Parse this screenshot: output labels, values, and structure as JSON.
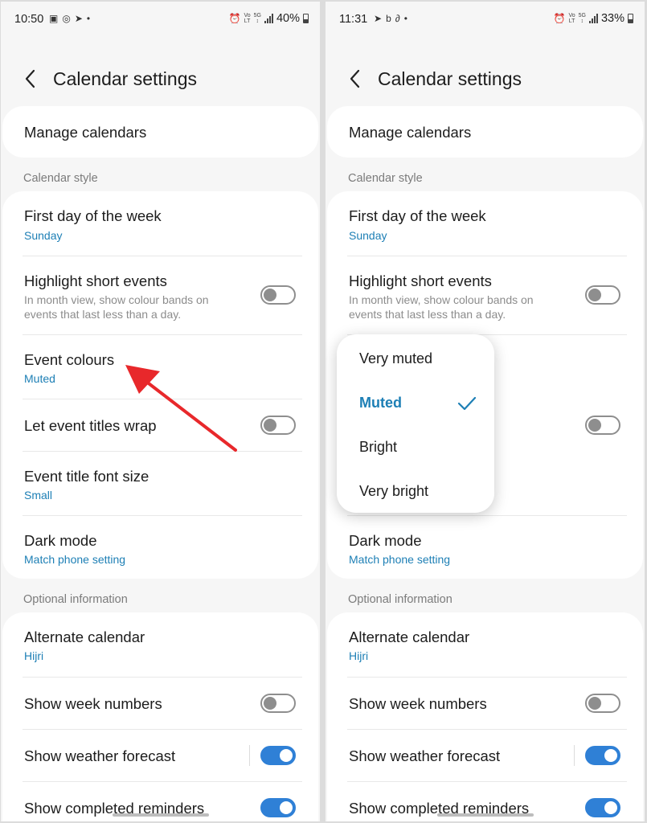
{
  "left": {
    "status": {
      "time": "10:50",
      "battery": "40%",
      "dot": "•"
    },
    "title": "Calendar settings",
    "manage": "Manage calendars",
    "section_style": "Calendar style",
    "first_day": {
      "label": "First day of the week",
      "value": "Sunday"
    },
    "highlight": {
      "label": "Highlight short events",
      "desc": "In month view, show colour bands on events that last less than a day."
    },
    "event_colours": {
      "label": "Event colours",
      "value": "Muted"
    },
    "wrap": {
      "label": "Let event titles wrap"
    },
    "font_size": {
      "label": "Event title font size",
      "value": "Small"
    },
    "dark_mode": {
      "label": "Dark mode",
      "value": "Match phone setting"
    },
    "section_optional": "Optional information",
    "alt_cal": {
      "label": "Alternate calendar",
      "value": "Hijri"
    },
    "week_numbers": {
      "label": "Show week numbers"
    },
    "weather": {
      "label": "Show weather forecast"
    },
    "reminders": {
      "label": "Show completed reminders"
    }
  },
  "right": {
    "status": {
      "time": "11:31",
      "battery": "33%",
      "dot": "•"
    },
    "title": "Calendar settings",
    "manage": "Manage calendars",
    "section_style": "Calendar style",
    "first_day": {
      "label": "First day of the week",
      "value": "Sunday"
    },
    "highlight": {
      "label": "Highlight short events",
      "desc": "In month view, show colour bands on events that last less than a day."
    },
    "dark_mode": {
      "label": "Dark mode",
      "value": "Match phone setting"
    },
    "section_optional": "Optional information",
    "alt_cal": {
      "label": "Alternate calendar",
      "value": "Hijri"
    },
    "week_numbers": {
      "label": "Show week numbers"
    },
    "weather": {
      "label": "Show weather forecast"
    },
    "reminders": {
      "label": "Show completed reminders"
    },
    "popup": {
      "options": [
        "Very muted",
        "Muted",
        "Bright",
        "Very bright"
      ],
      "selected": "Muted"
    }
  },
  "colors": {
    "accent": "#1d7fb5",
    "toggle_on": "#2f80d6",
    "arrow": "#e8282b"
  }
}
